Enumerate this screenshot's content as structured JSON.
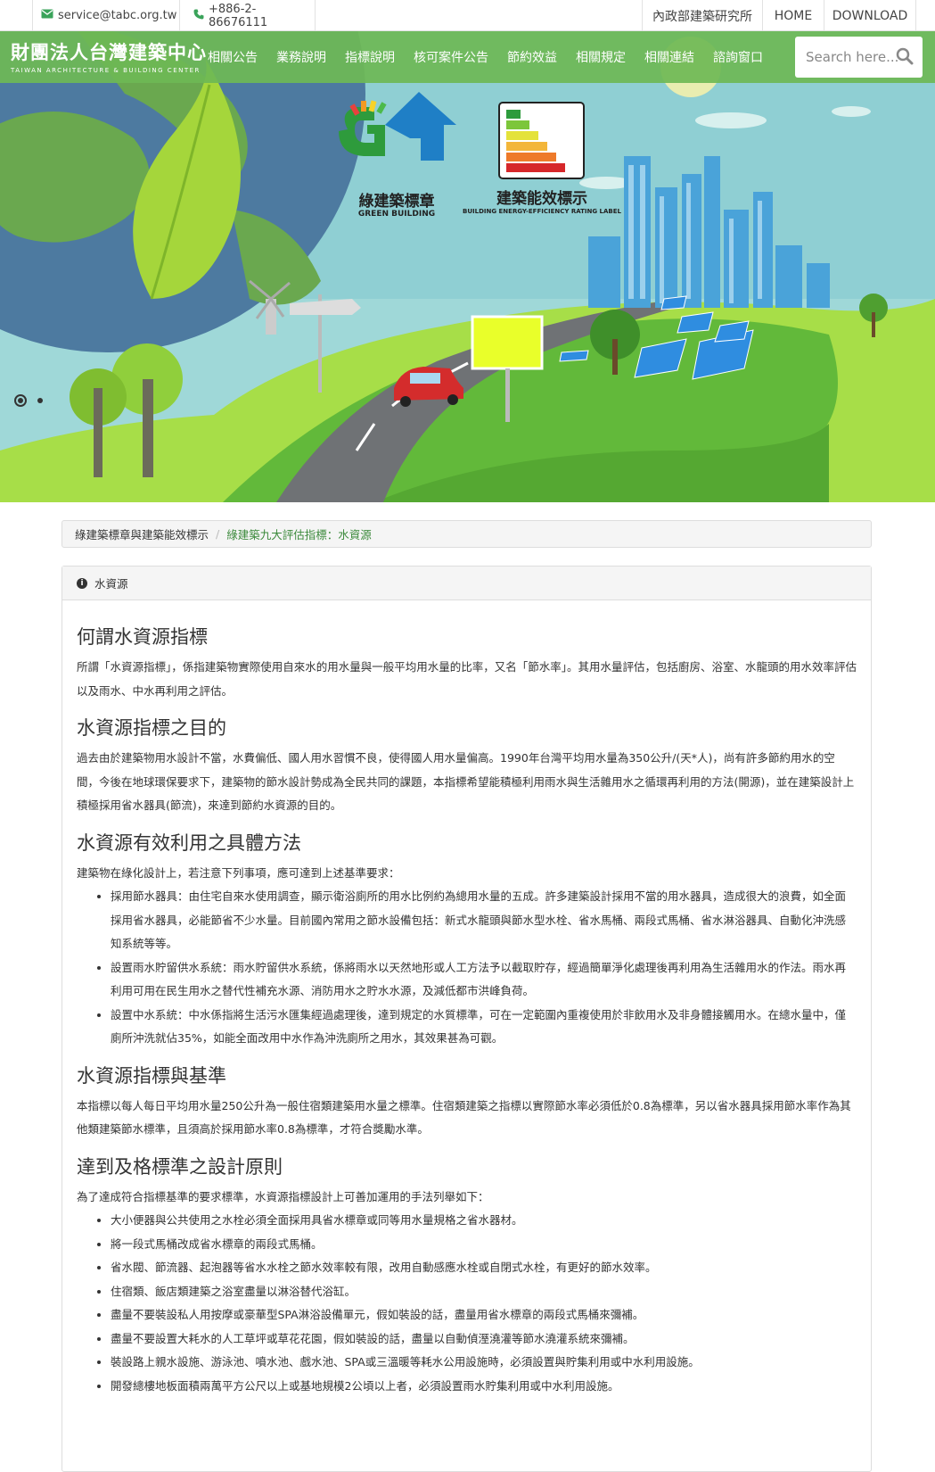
{
  "topbar": {
    "email": "service@tabc.org.tw",
    "phone": "+886-2-86676111",
    "links": [
      "內政部建築研究所",
      "HOME",
      "DOWNLOAD"
    ]
  },
  "brand": {
    "name": "財團法人台灣建築中心",
    "english": "TAIWAN ARCHITECTURE & BUILDING CENTER"
  },
  "nav": [
    "相關公告",
    "業務說明",
    "指標說明",
    "核可案件公告",
    "節約效益",
    "相關規定",
    "相關連結",
    "諮詢窗口"
  ],
  "search": {
    "placeholder": "Search here..."
  },
  "banner": {
    "green_label": "綠建築標章",
    "green_en": "GREEN BUILDING",
    "energy_label": "建築能效標示",
    "energy_en": "BUILDING ENERGY-EFFICIENCY RATING LABEL"
  },
  "breadcrumb": [
    "綠建築標章與建築能效標示",
    "綠建築九大評估指標：水資源"
  ],
  "panel_title": "水資源",
  "sections": [
    {
      "heading": "何謂水資源指標",
      "paras": [
        "所謂「水資源指標」，係指建築物實際使用自來水的用水量與一般平均用水量的比率，又名「節水率」。其用水量評估，包括廚房、浴室、水龍頭的用水效率評估以及雨水、中水再利用之評估。"
      ]
    },
    {
      "heading": "水資源指標之目的",
      "paras": [
        "過去由於建築物用水設計不當，水費偏低、國人用水習慣不良，使得國人用水量偏高。1990年台灣平均用水量為350公升/(天*人)，尚有許多節約用水的空間，今後在地球環保要求下，建築物的節水設計勢成為全民共同的課題，本指標希望能積極利用雨水與生活雜用水之循環再利用的方法(開源)，並在建築設計上積極採用省水器具(節流)，來達到節約水資源的目的。"
      ]
    },
    {
      "heading": "水資源有效利用之具體方法",
      "paras": [
        "建築物在綠化設計上，若注意下列事項，應可達到上述基準要求："
      ],
      "list": [
        "採用節水器具：由住宅自來水使用調查，顯示衛浴廁所的用水比例約為總用水量的五成。許多建築設計採用不當的用水器具，造成很大的浪費，如全面採用省水器具，必能節省不少水量。目前國內常用之節水設備包括：新式水龍頭與節水型水栓、省水馬桶、兩段式馬桶、省水淋浴器具、自動化沖洗感知系統等等。",
        "設置雨水貯留供水系統：雨水貯留供水系統，係將雨水以天然地形或人工方法予以截取貯存，經過簡單淨化處理後再利用為生活雜用水的作法。雨水再利用可用在民生用水之替代性補充水源、消防用水之貯水水源，及減低都市洪峰負荷。",
        "設置中水系統：中水係指將生活污水匯集經過處理後，達到規定的水質標準，可在一定範圍內重複使用於非飲用水及非身體接觸用水。在總水量中，僅廁所沖洗就佔35%，如能全面改用中水作為沖洗廁所之用水，其效果甚為可觀。"
      ]
    },
    {
      "heading": "水資源指標與基準",
      "paras": [
        "本指標以每人每日平均用水量250公升為一般住宿類建築用水量之標準。住宿類建築之指標以實際節水率必須低於0.8為標準，另以省水器具採用節水率作為其他類建築節水標準，且須高於採用節水率0.8為標準，才符合獎勵水準。"
      ]
    },
    {
      "heading": "達到及格標準之設計原則",
      "paras": [
        "為了達成符合指標基準的要求標準，水資源指標設計上可善加運用的手法列舉如下："
      ],
      "list": [
        "大小便器與公共使用之水栓必須全面採用具省水標章或同等用水量規格之省水器材。",
        "將一段式馬桶改成省水標章的兩段式馬桶。",
        "省水閥、節流器、起泡器等省水水栓之節水效率較有限，改用自動感應水栓或自閉式水栓，有更好的節水效率。",
        "住宿類、飯店類建築之浴室盡量以淋浴替代浴缸。",
        "盡量不要裝設私人用按摩或豪華型SPA淋浴設備單元，假如裝設的話，盡量用省水標章的兩段式馬桶來彌補。",
        "盡量不要設置大耗水的人工草坪或草花花園，假如裝設的話，盡量以自動偵溼澆灌等節水澆灌系統來彌補。",
        "裝設路上親水設施、游泳池、噴水池、戲水池、SPA或三溫暖等耗水公用設施時，必須設置與貯集利用或中水利用設施。",
        "開發總樓地板面積兩萬平方公尺以上或基地規模2公頃以上者，必須設置雨水貯集利用或中水利用設施。"
      ]
    }
  ],
  "colors": {
    "nav_green": "#6eb955",
    "sky": "#8fd0d4",
    "grass": "#7cc83a",
    "link_green": "#3c8a3c"
  }
}
